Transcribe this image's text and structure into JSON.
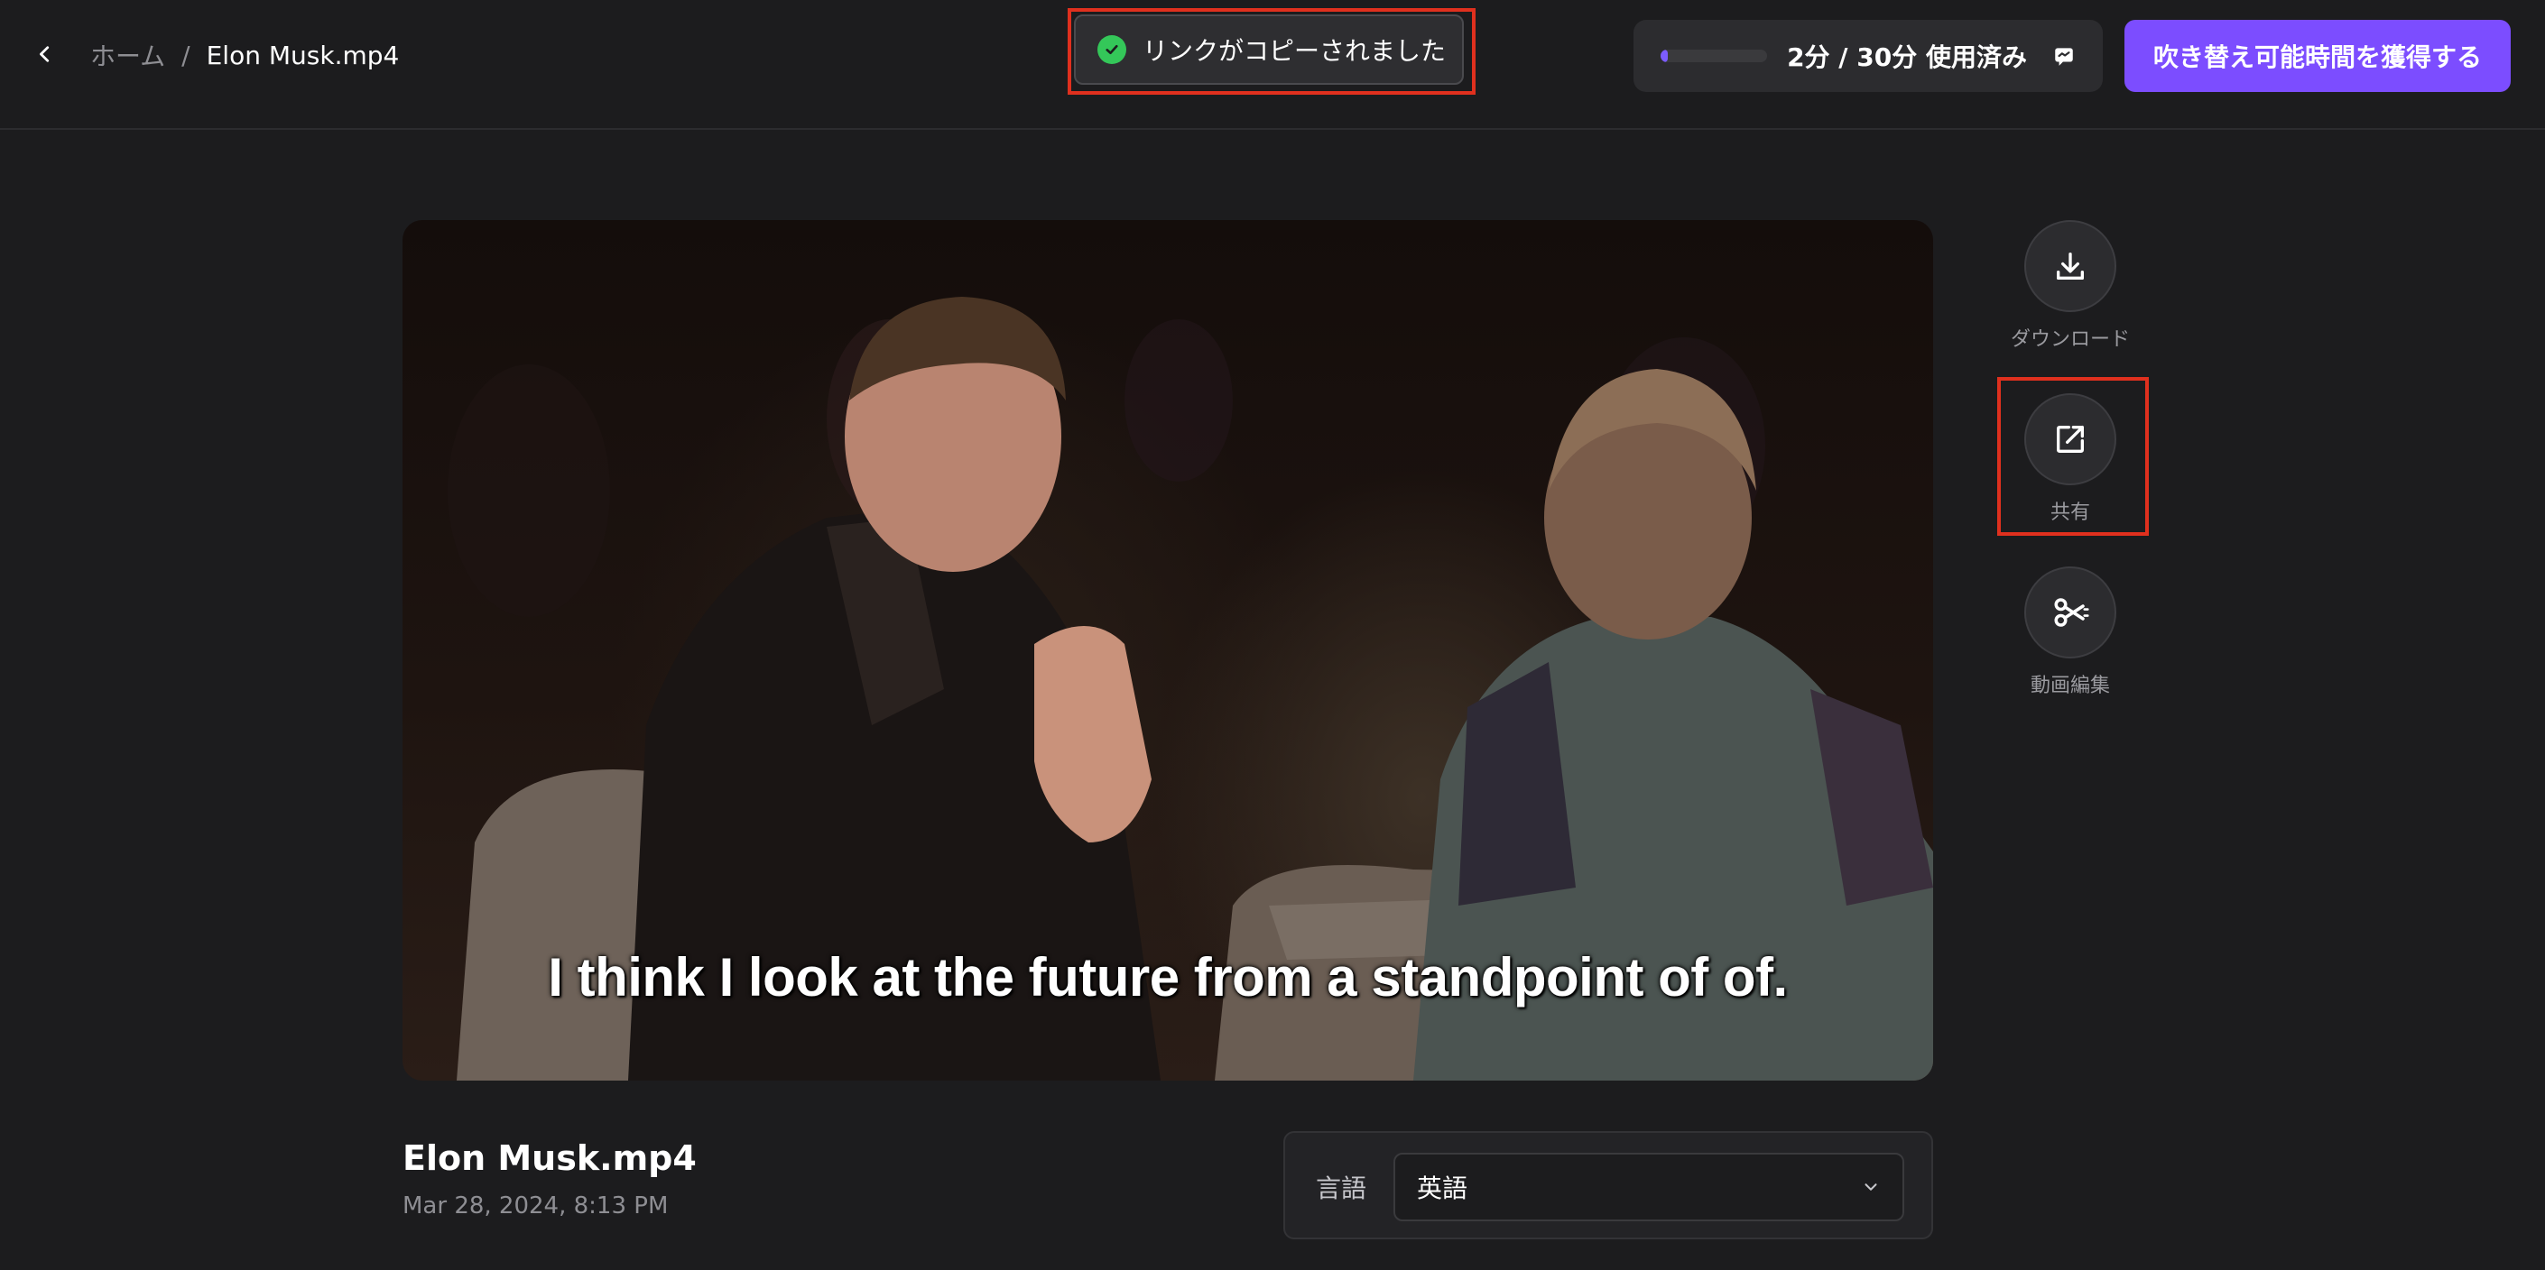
{
  "breadcrumb": {
    "home": "ホーム",
    "separator": "/",
    "current": "Elon Musk.mp4"
  },
  "toast": {
    "message": "リンクがコピーされました",
    "status": "success"
  },
  "usage": {
    "text": "2分 / 30分 使用済み",
    "used_minutes": 2,
    "total_minutes": 30
  },
  "cta": {
    "label": "吹き替え可能時間を獲得する"
  },
  "video": {
    "caption": "I think I look at the future from a standpoint of of."
  },
  "actions": {
    "download": "ダウンロード",
    "share": "共有",
    "edit": "動画編集"
  },
  "file": {
    "title": "Elon Musk.mp4",
    "date": "Mar 28, 2024, 8:13 PM"
  },
  "language": {
    "label": "言語",
    "selected": "英語"
  },
  "colors": {
    "accent": "#7c4dff",
    "highlight": "#e0301e",
    "success": "#34c759",
    "background": "#1c1c1e"
  }
}
